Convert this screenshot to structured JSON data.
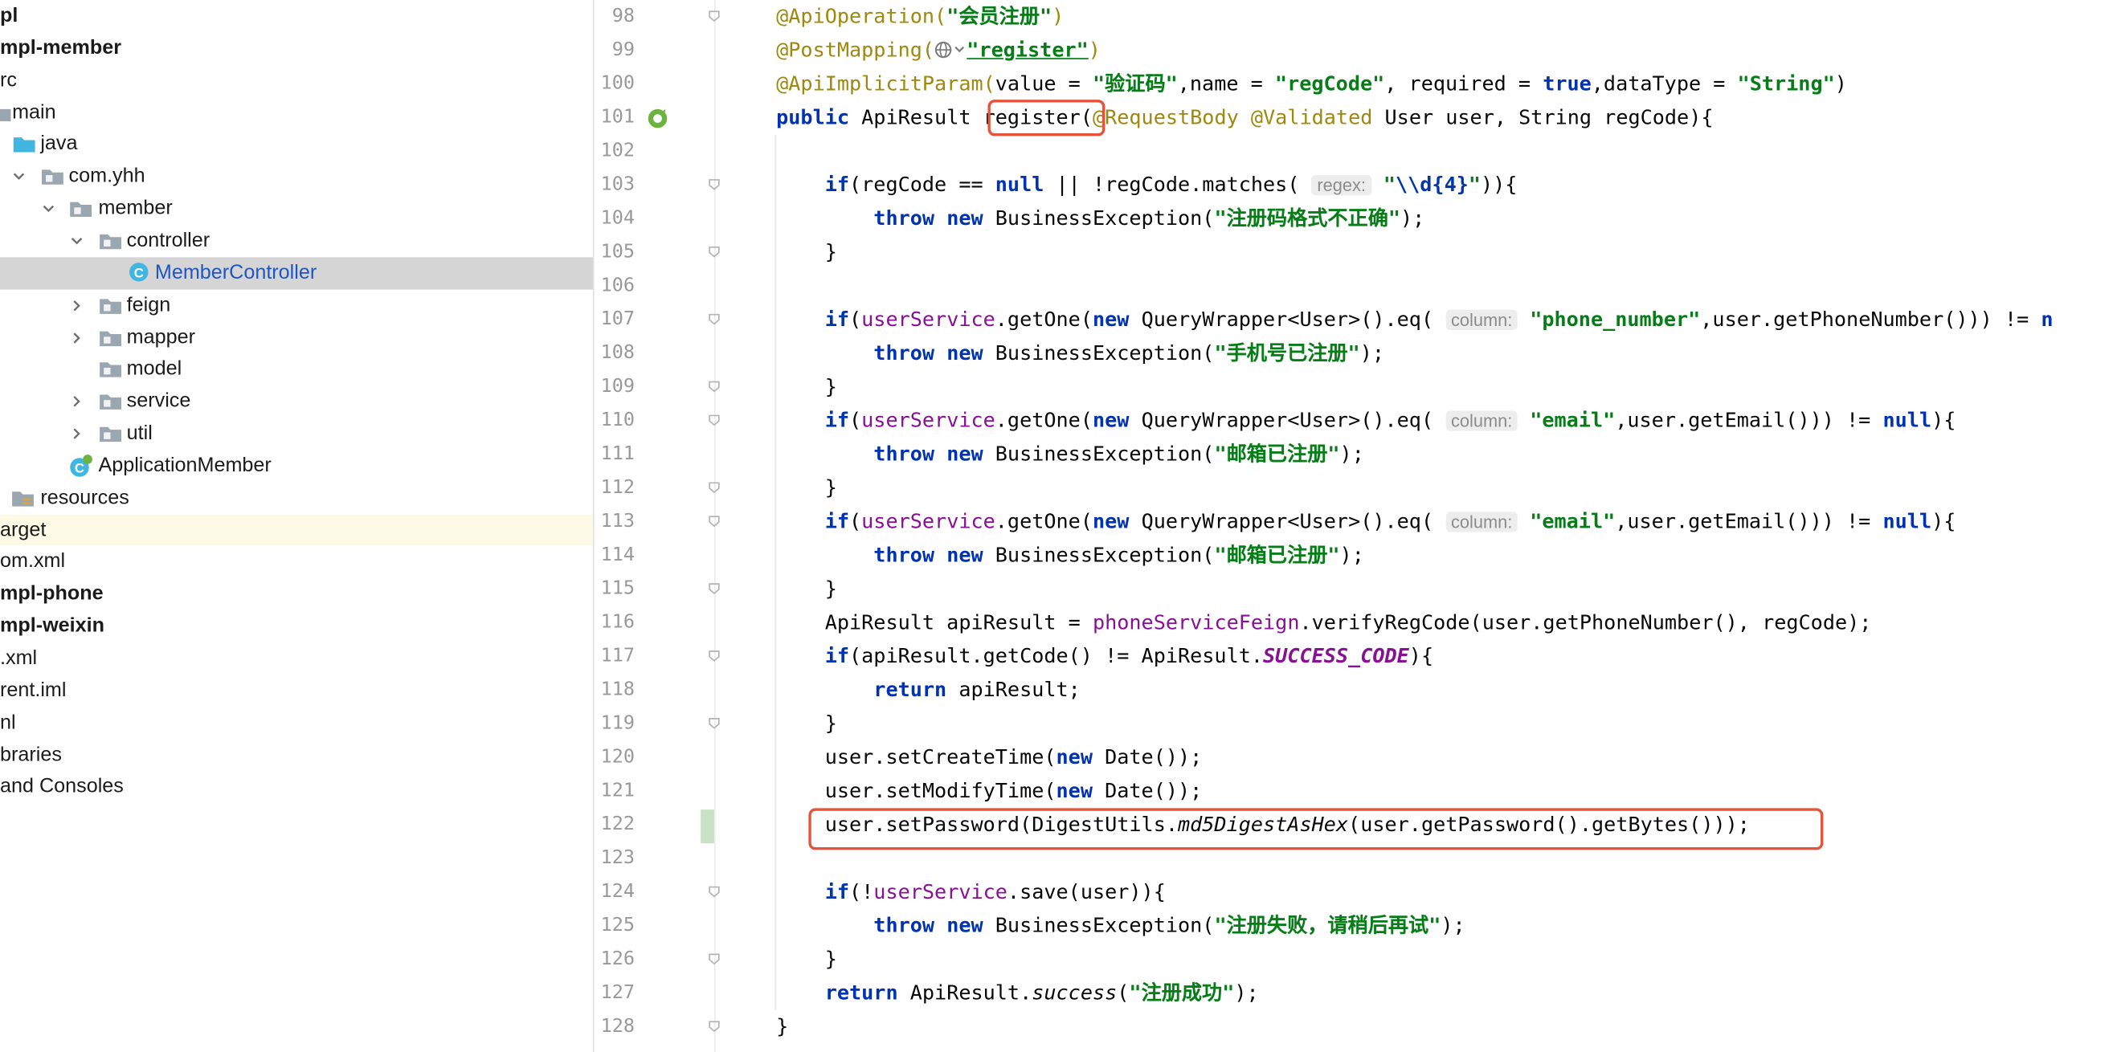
{
  "project_tree": [
    {
      "label": "pl",
      "bold": true,
      "icon": "none"
    },
    {
      "label": "mpl-member",
      "bold": true,
      "icon": "none"
    },
    {
      "label": "rc",
      "icon": "none"
    },
    {
      "label": "main",
      "icon": "folder"
    },
    {
      "label": "java",
      "icon": "source-folder"
    },
    {
      "label": "com.yhh",
      "icon": "package-folder"
    },
    {
      "label": "member",
      "icon": "package-folder"
    },
    {
      "label": "controller",
      "icon": "package-folder"
    },
    {
      "label": "MemberController",
      "icon": "class-icon",
      "selected": true
    },
    {
      "label": "feign",
      "icon": "package-folder"
    },
    {
      "label": "mapper",
      "icon": "package-folder"
    },
    {
      "label": "model",
      "icon": "package-folder"
    },
    {
      "label": "service",
      "icon": "package-folder"
    },
    {
      "label": "util",
      "icon": "package-folder"
    },
    {
      "label": "ApplicationMember",
      "icon": "spring-class-icon"
    },
    {
      "label": "resources",
      "icon": "resources-folder"
    },
    {
      "label": "arget",
      "icon": "none",
      "highlight": true
    },
    {
      "label": "om.xml",
      "icon": "none"
    },
    {
      "label": "mpl-phone",
      "bold": true,
      "icon": "none"
    },
    {
      "label": "mpl-weixin",
      "bold": true,
      "icon": "none"
    },
    {
      "label": ".xml",
      "icon": "none"
    },
    {
      "label": "rent.iml",
      "icon": "none"
    },
    {
      "label": "nl",
      "icon": "none"
    },
    {
      "label": "braries",
      "icon": "none"
    },
    {
      "label": " and Consoles",
      "icon": "none"
    }
  ],
  "editor": {
    "line_numbers": [
      "98",
      "99",
      "100",
      "101",
      "102",
      "103",
      "104",
      "105",
      "106",
      "107",
      "108",
      "109",
      "110",
      "111",
      "112",
      "113",
      "114",
      "115",
      "116",
      "117",
      "118",
      "119",
      "120",
      "121",
      "122",
      "123",
      "124",
      "125",
      "126",
      "127",
      "128"
    ],
    "hints": {
      "regex": "regex:",
      "column": "column:"
    },
    "strings": {
      "api_operation": "\"会员注册\"",
      "post_mapping": "\"register\"",
      "param_value": "\"验证码\"",
      "param_name": "\"regCode\"",
      "param_type": "\"String\"",
      "regex_open": "\"",
      "regex_escape": "\\\\d",
      "regex_quant": "{4}",
      "regex_close": "\"",
      "err_format": "\"注册码格式不正确\"",
      "phone_col": "\"phone_number\"",
      "err_phone": "\"手机号已注册\"",
      "email_col": "\"email\"",
      "err_email": "\"邮箱已注册\"",
      "err_save": "\"注册失败，请稍后再试\"",
      "success": "\"注册成功\""
    },
    "method_name": "register",
    "highlighted_line": "user.setPassword(DigestUtils.md5DigestAsHex(user.getPassword().getBytes()));",
    "colors": {
      "highlight_box": "#e5533a",
      "keyword": "#0033b3",
      "string": "#067d17",
      "annotation": "#9e880d",
      "field": "#871094"
    }
  }
}
